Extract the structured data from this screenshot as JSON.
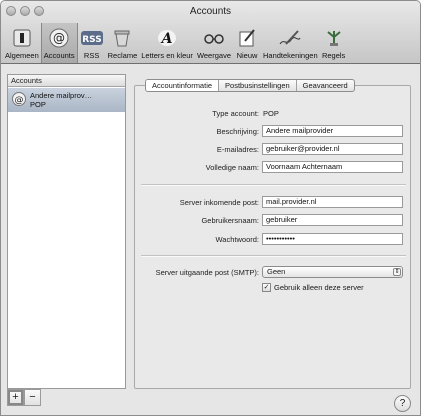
{
  "window": {
    "title": "Accounts"
  },
  "toolbar": {
    "items": [
      {
        "label": "Algemeen",
        "icon": "general-switch-icon"
      },
      {
        "label": "Accounts",
        "icon": "at-sign-icon"
      },
      {
        "label": "RSS",
        "icon": "rss-icon"
      },
      {
        "label": "Reclame",
        "icon": "junk-mail-icon"
      },
      {
        "label": "Letters en kleur",
        "icon": "fonts-icon"
      },
      {
        "label": "Weergave",
        "icon": "glasses-icon"
      },
      {
        "label": "Nieuw",
        "icon": "compose-icon"
      },
      {
        "label": "Handtekeningen",
        "icon": "signature-pen-icon"
      },
      {
        "label": "Regels",
        "icon": "rules-icon"
      }
    ],
    "selected": "Accounts"
  },
  "accounts": {
    "header": "Accounts",
    "items": [
      {
        "name": "Andere mailprov…",
        "type": "POP"
      }
    ]
  },
  "tabs": [
    "Accountinformatie",
    "Postbusinstellingen",
    "Geavanceerd"
  ],
  "form": {
    "type_label": "Type account:",
    "type_value": "POP",
    "description_label": "Beschrijving:",
    "description_value": "Andere mailprovider",
    "email_label": "E-mailadres:",
    "email_value": "gebruiker@provider.nl",
    "fullname_label": "Volledige naam:",
    "fullname_value": "Voornaam Achternaam",
    "incoming_label": "Server inkomende post:",
    "incoming_value": "mail.provider.nl",
    "username_label": "Gebruikersnaam:",
    "username_value": "gebruiker",
    "password_label": "Wachtwoord:",
    "password_value": "•••••••••••",
    "smtp_label": "Server uitgaande post (SMTP):",
    "smtp_value": "Geen",
    "only_server_label": "Gebruik alleen deze server",
    "only_server_checked": true
  },
  "bottom": {
    "add": "+",
    "remove": "−",
    "help": "?"
  }
}
